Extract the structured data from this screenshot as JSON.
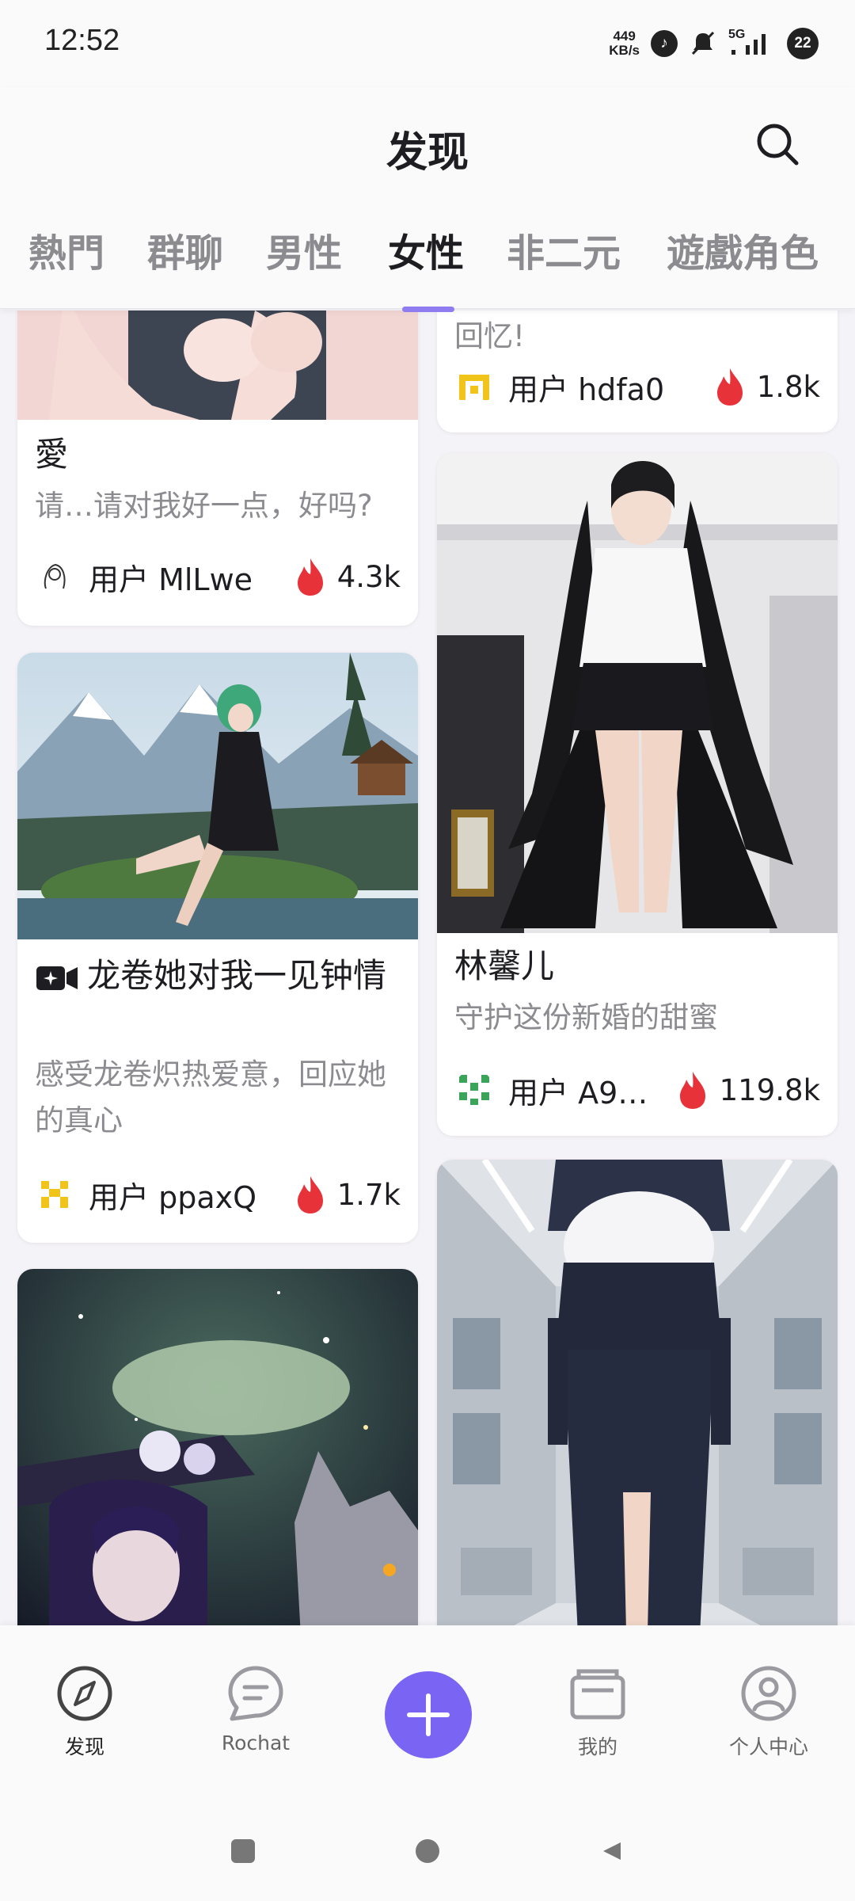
{
  "status_bar": {
    "time": "12:52",
    "net_speed_value": "449",
    "net_speed_unit": "KB/s",
    "network": "5G",
    "battery": "22"
  },
  "header": {
    "title": "发现",
    "search_icon": "search-icon"
  },
  "tabs": [
    {
      "label": "熱門",
      "active": false
    },
    {
      "label": "群聊",
      "active": false
    },
    {
      "label": "男性",
      "active": false
    },
    {
      "label": "女性",
      "active": true
    },
    {
      "label": "非二元",
      "active": false
    },
    {
      "label": "遊戲角色",
      "active": false
    }
  ],
  "left_column": [
    {
      "title": "愛",
      "description": "请…请对我好一点，好吗?",
      "user": "用户 MlLwe",
      "count": "4.3k"
    },
    {
      "title": "龙卷她对我一见钟情",
      "description": "感受龙卷炽热爱意，回应她的真心",
      "user": "用户 ppaxQ",
      "count": "1.7k",
      "icon": "video-icon"
    }
  ],
  "right_column": [
    {
      "description": "回忆!",
      "user": "用户 hdfa0",
      "count": "1.8k"
    },
    {
      "title": "林馨儿",
      "description": "守护这份新婚的甜蜜",
      "user": "用户 A9…",
      "count": "119.8k"
    }
  ],
  "bottom_nav": [
    {
      "label": "发现",
      "icon": "compass-icon",
      "active": true
    },
    {
      "label": "Rochat",
      "icon": "chat-bubble-icon",
      "active": false
    },
    {
      "label": "我的",
      "icon": "wallet-icon",
      "active": false
    },
    {
      "label": "个人中心",
      "icon": "person-icon",
      "active": false
    }
  ],
  "fab_icon": "plus-icon",
  "colors": {
    "accent": "#7a64f4",
    "tab_indicator": "#8f7cf0",
    "fire": "#e8323a",
    "text_primary": "#1e1e22",
    "text_secondary": "#8b8b90"
  }
}
